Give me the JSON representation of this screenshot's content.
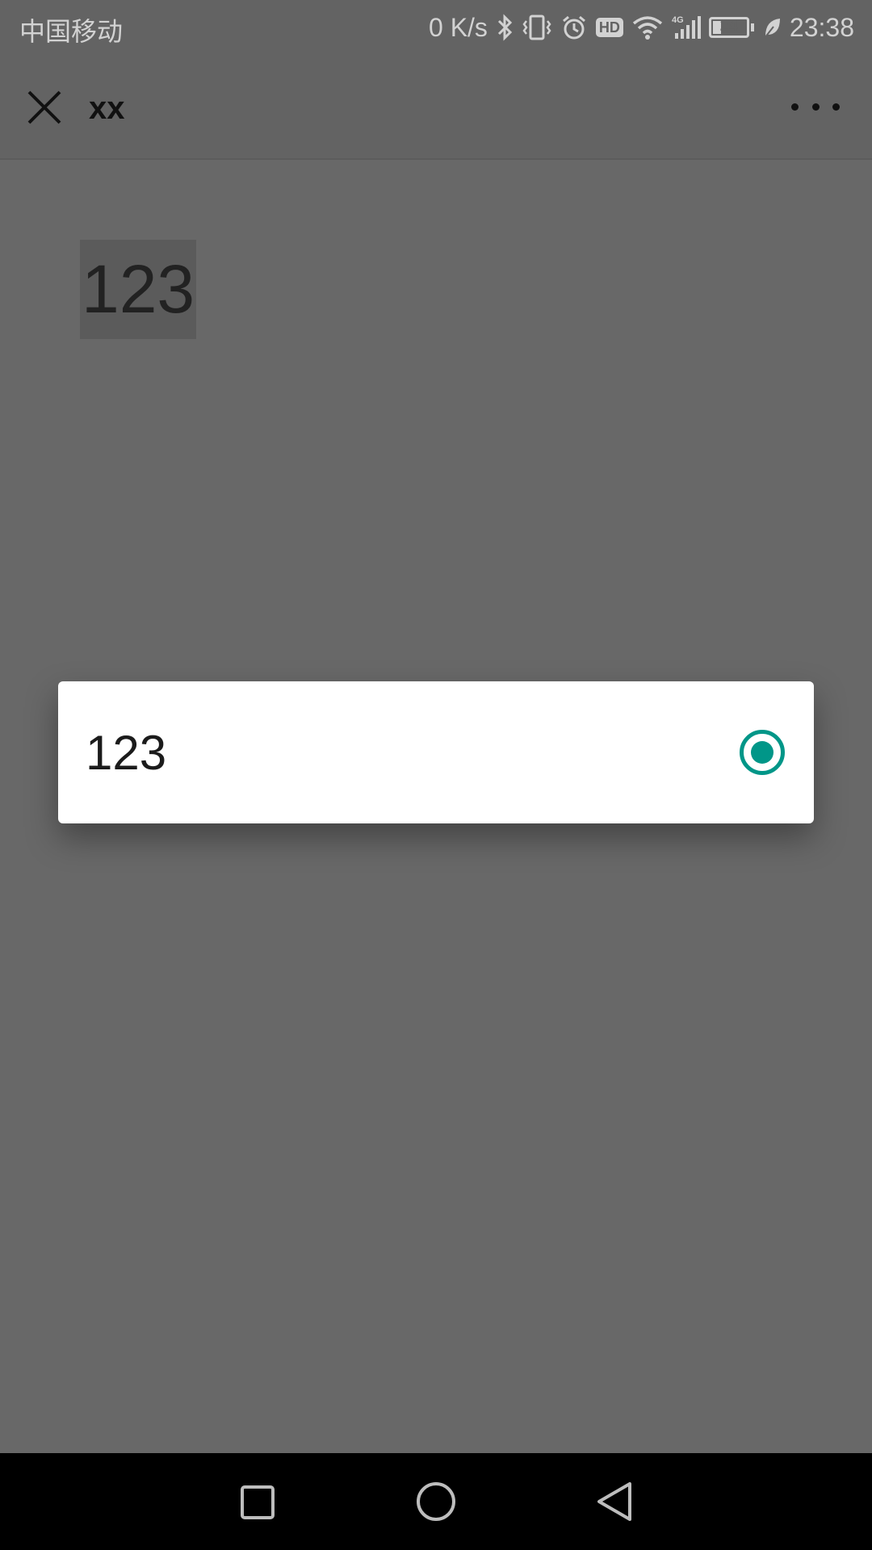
{
  "status_bar": {
    "carrier": "中国移动",
    "speed": "0 K/s",
    "hd": "HD",
    "network": "4G",
    "battery_level": "24",
    "time": "23:38"
  },
  "nav": {
    "title": "xx"
  },
  "page": {
    "selected_text": "123"
  },
  "dialog": {
    "option_label": "123",
    "option_selected": true,
    "accent_color": "#009688"
  },
  "system_nav": {
    "icons": [
      "recents-square-icon",
      "home-circle-icon",
      "back-triangle-icon"
    ]
  }
}
